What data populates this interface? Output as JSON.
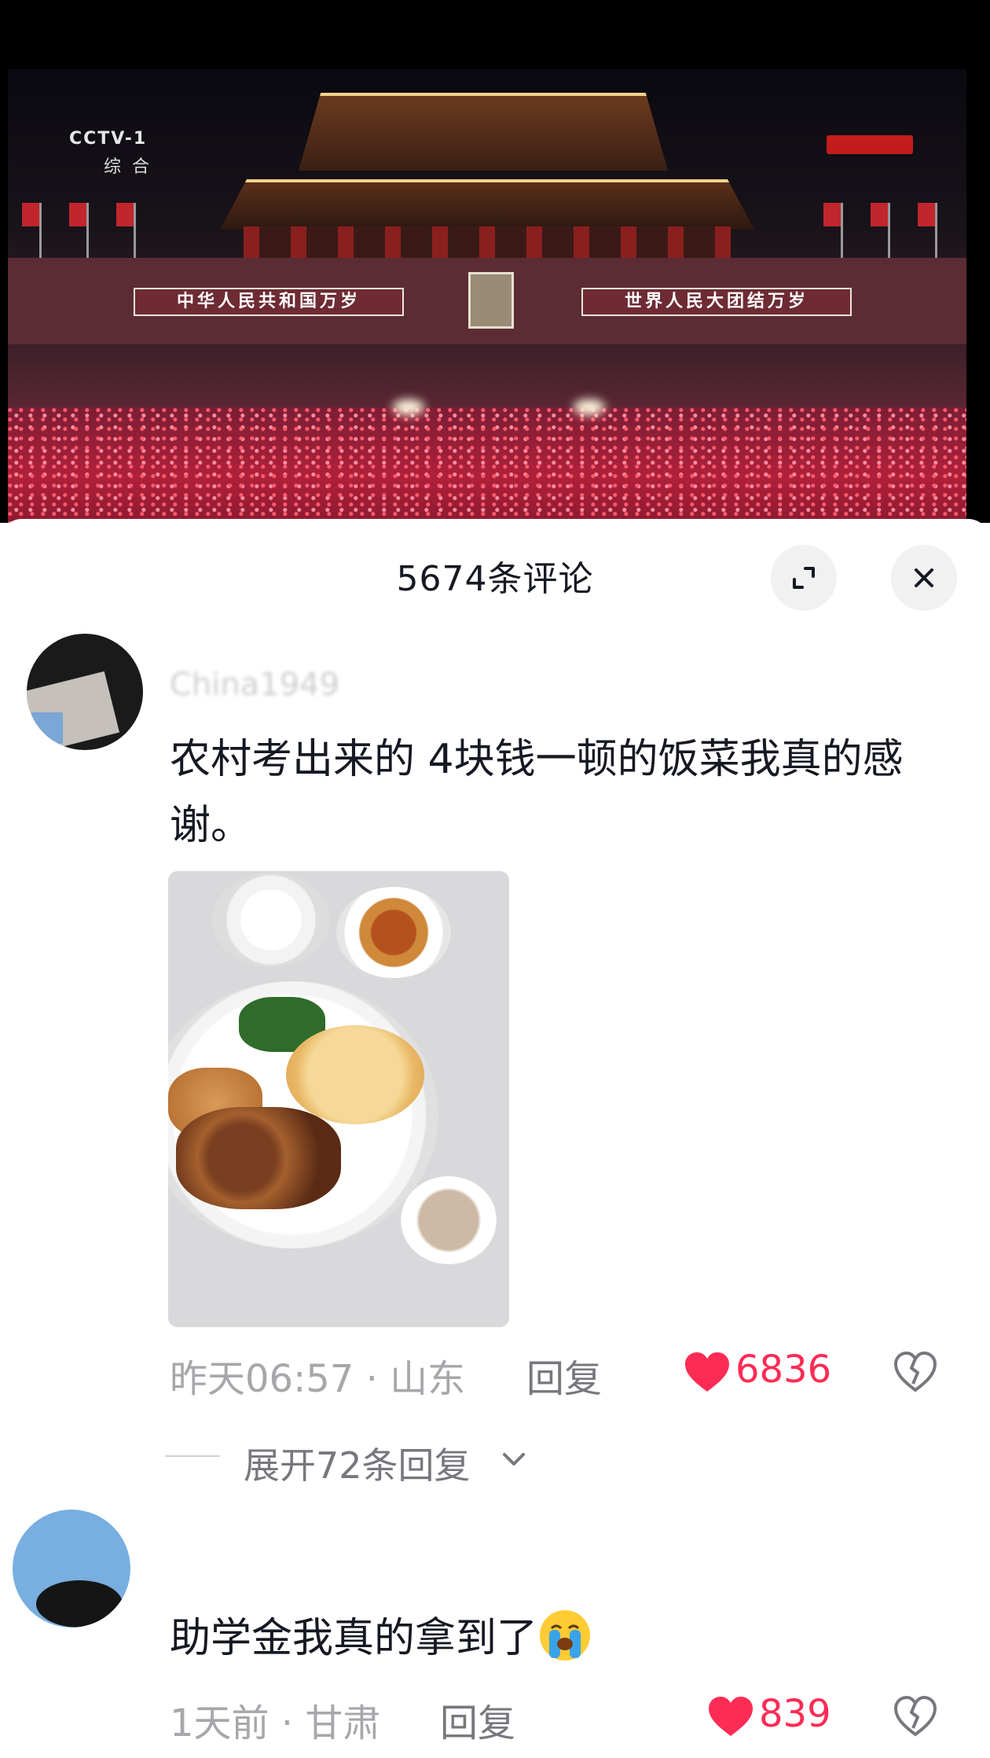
{
  "video": {
    "channel_logo": "CCTV-1",
    "channel_sub": "综合",
    "banner_left": "中华人民共和国万岁",
    "banner_right": "世界人民大团结万岁"
  },
  "comments_panel": {
    "title": "5674条评论",
    "expand_icon": "fullscreen-expand-icon",
    "close_icon": "close-icon"
  },
  "comments": [
    {
      "username": "China1949",
      "text": "农村考出来的  4块钱一顿的饭菜我真的感谢。",
      "has_image": true,
      "time_location": "昨天06:57 · 山东",
      "reply_label": "回复",
      "likes": "6836",
      "liked": true,
      "expand_replies": "展开72条回复"
    },
    {
      "username": "",
      "text": "助学金我真的拿到了",
      "emoji": "loudly-crying-face",
      "time_location": "1天前 · 甘肃",
      "reply_label": "回复",
      "likes": "839",
      "liked": true
    }
  ],
  "colors": {
    "like_red": "#fe2c55",
    "text_primary": "#161823",
    "text_secondary": "#a7a7ab"
  }
}
